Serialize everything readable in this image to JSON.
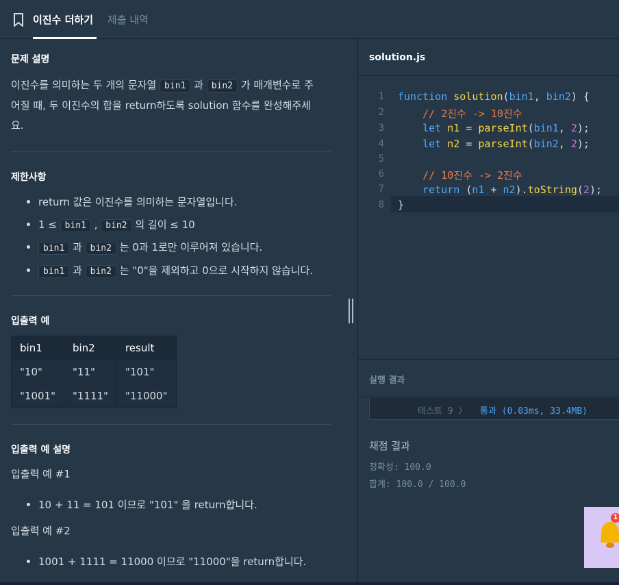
{
  "tabs": {
    "active": "이진수 더하기",
    "inactive": "제출 내역"
  },
  "problem": {
    "heading": "문제 설명",
    "line1_a": "이진수를 의미하는 두 개의 문자열 ",
    "bin1": "bin1",
    "line1_b": " 과 ",
    "bin2": "bin2",
    "line1_c": " 가 매개변수로 주",
    "line2": "어질 때, 두 이진수의 합을 return하도록 solution 함수를 완성해주세",
    "line3": "요."
  },
  "constraints": {
    "heading": "제한사항",
    "c1": "return 값은 이진수를 의미하는 문자열입니다.",
    "c2_a": "1 ≤ ",
    "c2_sep": " , ",
    "c2_b": " 의 길이 ≤ 10",
    "c3_mid": " 과 ",
    "c3_end": " 는 0과 1로만 이루어져 있습니다.",
    "c4_mid": " 과 ",
    "c4_end": " 는 \"0\"을 제외하고 0으로 시작하지 않습니다."
  },
  "io": {
    "heading": "입출력 예",
    "headers": [
      "bin1",
      "bin2",
      "result"
    ],
    "rows": [
      [
        "\"10\"",
        "\"11\"",
        "\"101\""
      ],
      [
        "\"1001\"",
        "\"1111\"",
        "\"11000\""
      ]
    ]
  },
  "explain": {
    "heading": "입출력 예 설명",
    "ex1_title": "입출력 예 #1",
    "ex1": "10 + 11 = 101 이므로 \"101\" 을 return합니다.",
    "ex2_title": "입출력 예 #2",
    "ex2": "1001 + 1111 = 11000 이므로 \"11000\"을 return합니다."
  },
  "editor": {
    "filename": "solution.js",
    "line_numbers": [
      "1",
      "2",
      "3",
      "4",
      "5",
      "6",
      "7",
      "8"
    ],
    "l1": {
      "kw": "function",
      "fn": "solution",
      "open": "(",
      "p1": "bin1",
      "comma": ", ",
      "p2": "bin2",
      "close": ") {"
    },
    "l2": "// 2진수 -> 10진수",
    "l3": {
      "kw": "let",
      "var": "n1",
      "eq": " = ",
      "fn": "parseInt",
      "open": "(",
      "arg": "bin1",
      "comma": ", ",
      "num": "2",
      "close": ");"
    },
    "l4": {
      "kw": "let",
      "var": "n2",
      "eq": " = ",
      "fn": "parseInt",
      "open": "(",
      "arg": "bin2",
      "comma": ", ",
      "num": "2",
      "close": ");"
    },
    "l6": "// 10진수 -> 2진수",
    "l7": {
      "kw": "return",
      "open": " (",
      "a": "n1",
      "plus": " + ",
      "b": "n2",
      "mid": ").",
      "fn": "toString",
      "p": "(",
      "num": "2",
      "close": ");"
    },
    "l8": "}"
  },
  "results": {
    "heading": "실행 결과",
    "test_label": "테스트 9 〉",
    "test_status": "통과 (0.03ms, 33.4MB)",
    "grade_title": "채점 결과",
    "accuracy": "정확성: 100.0",
    "total": "합계: 100.0 / 100.0"
  },
  "notification": {
    "count": "1"
  },
  "colors": {
    "bg": "#263747",
    "accent_blue": "#4fa8ff",
    "func_yellow": "#f7d84a",
    "comment_orange": "#ee7b4e",
    "number_purple": "#c678dd"
  }
}
